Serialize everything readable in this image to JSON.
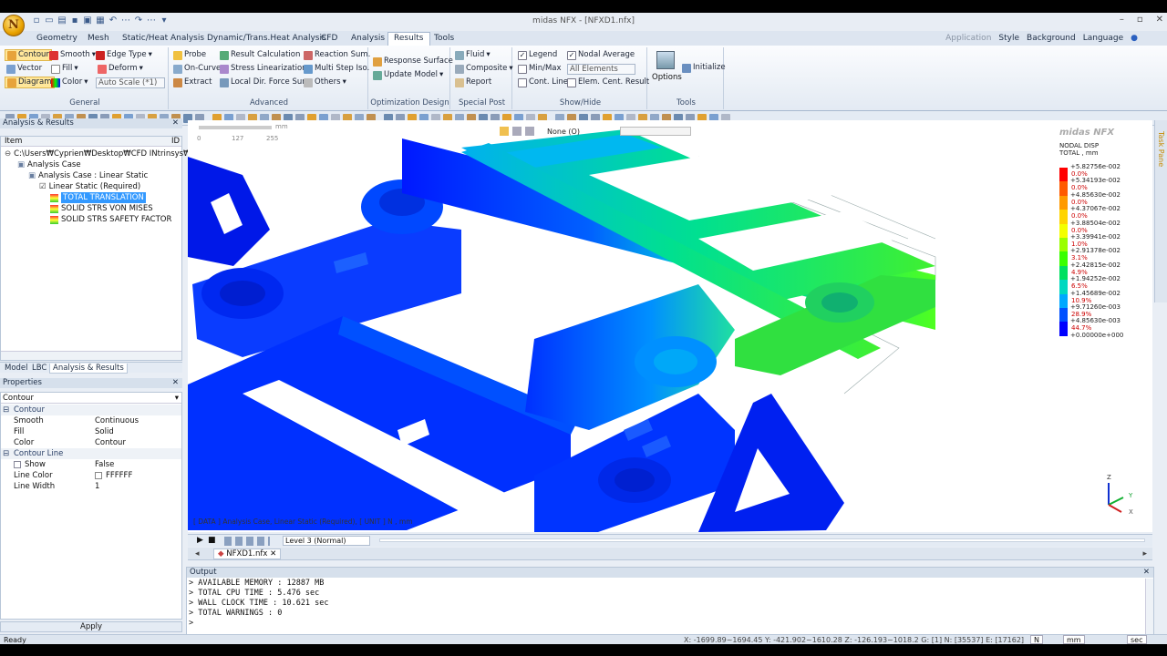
{
  "window": {
    "title": "midas NFX - [NFXD1.nfx]",
    "app_button": "N"
  },
  "menu": {
    "tabs": [
      "Geometry",
      "Mesh",
      "Static/Heat Analysis",
      "Dynamic/Trans.Heat Analysis",
      "CFD",
      "Analysis",
      "Results",
      "Tools"
    ],
    "active": "Results",
    "right": {
      "application": "Application",
      "style": "Style",
      "background": "Background",
      "language": "Language"
    }
  },
  "ribbon": {
    "general": {
      "title": "General",
      "contour": "Contour",
      "smooth": "Smooth",
      "edge_type": "Edge Type",
      "vector": "Vector",
      "fill": "Fill",
      "deform": "Deform",
      "diagram": "Diagram",
      "color": "Color",
      "auto_scale": "Auto Scale (*1)"
    },
    "advanced": {
      "title": "Advanced",
      "probe": "Probe",
      "result_calc": "Result Calculation",
      "reaction_sum": "Reaction Sum.",
      "on_curve": "On-Curve",
      "stress_lin": "Stress Linearization",
      "multi_step": "Multi Step Iso.",
      "extract": "Extract",
      "local_dir": "Local Dir. Force Sum",
      "others": "Others"
    },
    "optimization": {
      "title": "Optimization Design",
      "response_surface": "Response Surface",
      "update_model": "Update Model"
    },
    "special": {
      "title": "Special Post",
      "fluid": "Fluid",
      "composite": "Composite",
      "report": "Report"
    },
    "showhide": {
      "title": "Show/Hide",
      "legend": "Legend",
      "nodal_average": "Nodal Average",
      "min_max": "Min/Max",
      "all_elements": "All Elements",
      "cont_line": "Cont. Line",
      "elem_cent": "Elem. Cent. Result"
    },
    "tools": {
      "title": "Tools",
      "options": "Options",
      "initialize": "Initialize"
    }
  },
  "tree": {
    "header": "Analysis & Results",
    "column": "Item",
    "column_id": "ID",
    "items": [
      {
        "label": "C:\\Users₩Cyprien₩Desktop₩CFD INtrinsys₩...",
        "level": 0
      },
      {
        "label": "Analysis Case",
        "level": 1
      },
      {
        "label": "Analysis Case : Linear Static",
        "level": 2
      },
      {
        "label": "Linear Static (Required)",
        "level": 3
      },
      {
        "label": "TOTAL TRANSLATION",
        "level": 4,
        "selected": true
      },
      {
        "label": "SOLID STRS VON MISES",
        "level": 4
      },
      {
        "label": "SOLID STRS SAFETY FACTOR",
        "level": 4
      }
    ]
  },
  "left_tabs": [
    "Model",
    "LBC",
    "Analysis & Results"
  ],
  "properties": {
    "header": "Properties",
    "selector": "Contour",
    "rows": [
      {
        "group": "Contour"
      },
      {
        "k": "Smooth",
        "v": "Continuous"
      },
      {
        "k": "Fill",
        "v": "Solid"
      },
      {
        "k": "Color",
        "v": "Contour"
      },
      {
        "group": "Contour Line"
      },
      {
        "k": "Show",
        "v": "False"
      },
      {
        "k": "Line Color",
        "v": "FFFFFF"
      },
      {
        "k": "Line Width",
        "v": "1"
      }
    ],
    "apply": "Apply"
  },
  "viewport": {
    "scale_labels": [
      "0",
      "127",
      "255"
    ],
    "scale_unit": "mm",
    "view_select": "None (O)",
    "data_strip": "[ DATA ]  Analysis Case,  Linear Static (Required),   [ UNIT ]   N , mm",
    "axis": {
      "z": "Z",
      "y": "Y",
      "x": "X"
    }
  },
  "legend": {
    "brand": "midas NFX",
    "title": "NODAL DISP",
    "subtitle": "TOTAL , mm",
    "values": [
      "+5.82756e-002",
      "+5.34193e-002",
      "+4.85630e-002",
      "+4.37067e-002",
      "+3.88504e-002",
      "+3.39941e-002",
      "+2.91378e-002",
      "+2.42815e-002",
      "+1.94252e-002",
      "+1.45689e-002",
      "+9.71260e-003",
      "+4.85630e-003",
      "+0.00000e+000"
    ],
    "percents": [
      "0.0%",
      "0.0%",
      "0.0%",
      "0.0%",
      "0.0%",
      "1.0%",
      "3.1%",
      "4.9%",
      "6.5%",
      "10.9%",
      "28.9%",
      "44.7%"
    ],
    "colors": [
      "#ff0000",
      "#ff5a00",
      "#ff9a00",
      "#ffd400",
      "#f4ff00",
      "#9aff00",
      "#3aff00",
      "#00e060",
      "#00d8c0",
      "#00a8ff",
      "#0050ff",
      "#0000ff"
    ]
  },
  "docbar": {
    "level": "Level 3 (Normal)"
  },
  "file_tab": "NFXD1.nfx",
  "output": {
    "header": "Output",
    "lines": [
      "> AVAILABLE MEMORY     : 12887 MB",
      "> TOTAL CPU TIME       : 5.476 sec",
      "> WALL CLOCK TIME      : 10.621 sec",
      "> TOTAL WARNINGS : 0",
      ">"
    ]
  },
  "status": {
    "left": "Ready",
    "coords": "X: -1699.89~1694.45  Y: -421.902~1610.28  Z: -126.193~1018.2  G: [1]  N: [35537]  E: [17162]",
    "unit_n": "N",
    "unit_mm": "mm",
    "unit_sec": "sec"
  },
  "taskpane": "Task Pane"
}
